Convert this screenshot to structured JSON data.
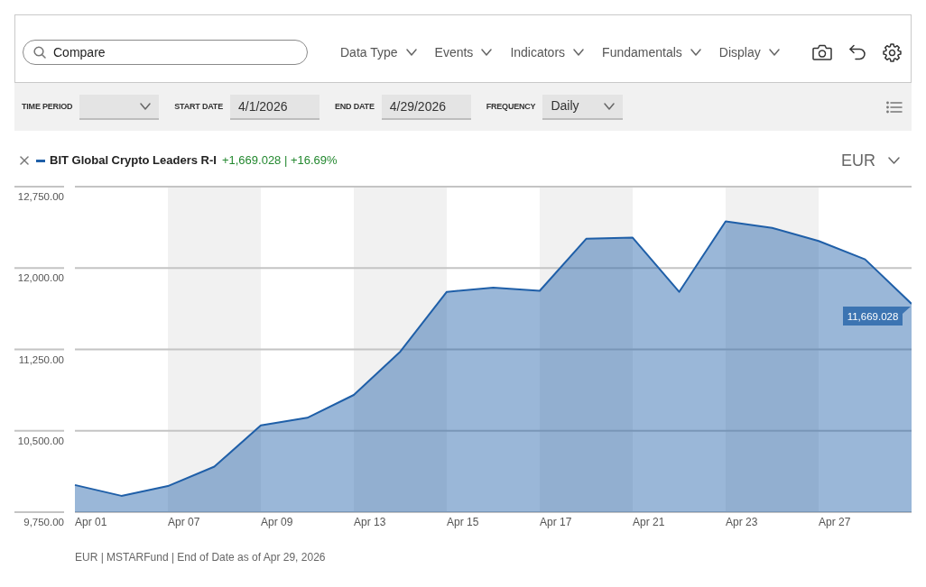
{
  "toolbar": {
    "search": {
      "placeholder": "Compare"
    },
    "menus": [
      "Data Type",
      "Events",
      "Indicators",
      "Fundamentals",
      "Display"
    ]
  },
  "filters": [
    {
      "kind": "select",
      "label": "TIME PERIOD"
    },
    {
      "kind": "date",
      "label": "START DATE",
      "value": "4/1/2026"
    },
    {
      "kind": "date",
      "label": "END DATE",
      "value": "4/29/2026"
    },
    {
      "kind": "select",
      "label": "FREQUENCY",
      "value": "Daily"
    }
  ],
  "chart": {
    "legend": [
      {
        "change": "+1,669.028 | +16.69%"
      }
    ],
    "currency": {
      "value": "EUR"
    },
    "last_value": "11,669.028",
    "chart_data": {
      "type": "area",
      "grid": true,
      "categories": [
        "Apr 01",
        null,
        "Apr 07",
        null,
        "Apr 09",
        null,
        "Apr 13",
        null,
        "Apr 15",
        null,
        "Apr 17",
        null,
        "Apr 21",
        null,
        "Apr 23",
        null,
        "Apr 27",
        null,
        null
      ],
      "ylim": [
        9750,
        12750
      ],
      "yticks": [
        {
          "value": 12750,
          "label": "12,750.00"
        },
        {
          "value": 12000,
          "label": "12,000.00"
        },
        {
          "value": 11250,
          "label": "11,250.00"
        },
        {
          "value": 10500,
          "label": "10,500.00"
        },
        {
          "value": 9750,
          "label": "9,750.00"
        }
      ],
      "series": [
        {
          "name": "BIT Global Crypto Leaders R-I",
          "color": "#1f5fa8",
          "values": [
            10000,
            9900,
            9990,
            10170,
            10550,
            10620,
            10830,
            11230,
            11780,
            11820,
            11790,
            12270,
            12280,
            11780,
            12430,
            12370,
            12250,
            12080,
            11670
          ]
        }
      ]
    }
  },
  "footer": "EUR | MSTARFund | End of Date as of Apr 29, 2026"
}
